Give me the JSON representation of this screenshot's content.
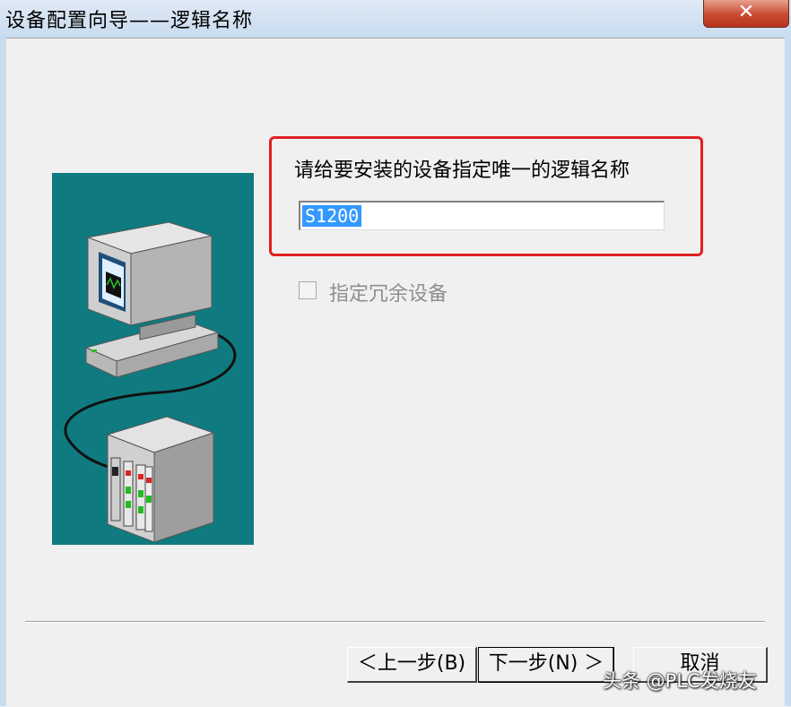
{
  "window": {
    "title": "设备配置向导——逻辑名称",
    "close_label": "✕"
  },
  "illustration": {
    "background": "#0f7b80",
    "icons": [
      "computer-monitor-icon",
      "plc-rack-icon",
      "cable-icon"
    ]
  },
  "form": {
    "prompt": "请给要安装的设备指定唯一的逻辑名称",
    "logical_name_value": "S1200",
    "redundant_checkbox_label": "指定冗余设备",
    "redundant_checked": false
  },
  "buttons": {
    "back": "＜上一步(B)",
    "next": "下一步(N) ＞",
    "cancel": "取消"
  },
  "watermark": "头条 @PLC发烧友",
  "colors": {
    "highlight": "#e02020",
    "selection": "#3399ff",
    "titlebar": "#c9dcf0",
    "close": "#c94a32"
  }
}
